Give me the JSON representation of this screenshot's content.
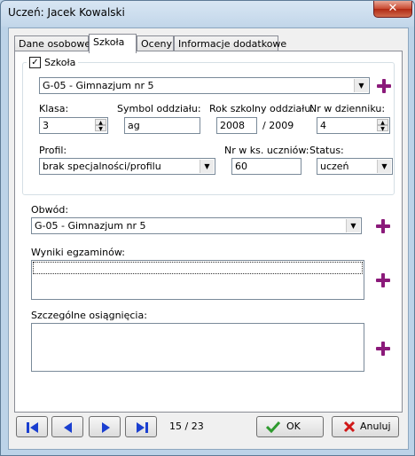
{
  "window": {
    "title": "Uczeń: Jacek Kowalski",
    "close_label": "✕"
  },
  "tabs": [
    {
      "label": "Dane osobowe",
      "active": false
    },
    {
      "label": "Szkoła",
      "active": true
    },
    {
      "label": "Oceny",
      "active": false
    },
    {
      "label": "Informacje dodatkowe",
      "active": false
    }
  ],
  "szkola_group": {
    "checkbox_label": "Szkoła",
    "checked": true,
    "check_mark": "✓",
    "school_value": "G-05 - Gimnazjum nr 5",
    "klasa_label": "Klasa:",
    "klasa_value": "3",
    "symbol_label": "Symbol oddziału:",
    "symbol_value": "ag",
    "rok_label": "Rok szkolny oddziału:",
    "rok_value": "2008",
    "rok_end": "/ 2009",
    "nr_label": "Nr w dzienniku:",
    "nr_value": "4",
    "profil_label": "Profil:",
    "profil_value": "brak specjalności/profilu",
    "nr_ks_label": "Nr w ks. uczniów:",
    "nr_ks_value": "60",
    "status_label": "Status:",
    "status_value": "uczeń"
  },
  "obwod": {
    "label": "Obwód:",
    "value": "G-05 - Gimnazjum nr 5"
  },
  "wyniki": {
    "label": "Wyniki egzaminów:",
    "value": ""
  },
  "osiagniecia": {
    "label": "Szczególne osiągnięcia:",
    "value": ""
  },
  "navigation": {
    "counter": "15 / 23"
  },
  "buttons": {
    "ok_label": "OK",
    "cancel_label": "Anuluj"
  },
  "colors": {
    "plus": "#8b1a7a",
    "nav_arrow": "#1a3fd0",
    "ok_check": "#2e9a2e",
    "cancel_x": "#d01818"
  }
}
